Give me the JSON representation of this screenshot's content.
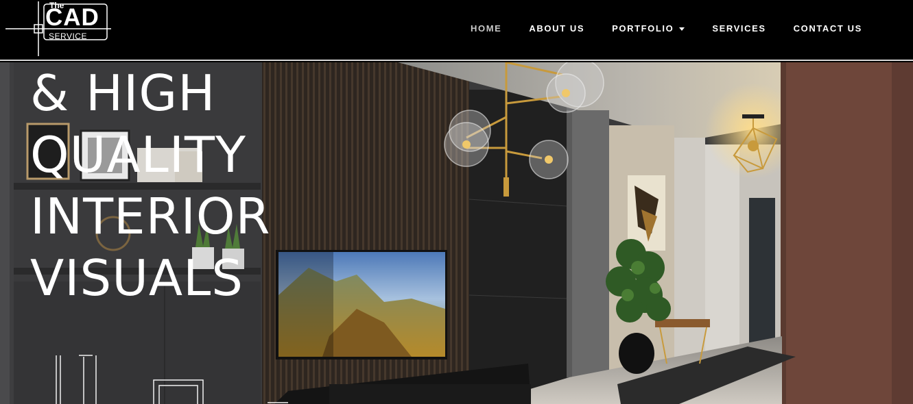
{
  "logo": {
    "the": "The",
    "cad": "CAD",
    "service": "SERVICE"
  },
  "nav": {
    "home": "HOME",
    "about": "ABOUT US",
    "portfolio": "PORTFOLIO",
    "services": "SERVICES",
    "contact": "CONTACT US",
    "active": "HOME"
  },
  "hero": {
    "headline_lines": [
      "& HIGH",
      "QUALITY",
      "INTERIOR",
      "VISUALS"
    ]
  },
  "colors": {
    "header_bg": "#000000",
    "nav_text": "#ffffff",
    "nav_active": "#c9c9c9",
    "accent_brass": "#c89a3c",
    "terracotta_wall": "#6e463a"
  },
  "icons": {
    "dropdown": "caret-down-icon",
    "logo_mark": "crosshair-logo-icon"
  }
}
